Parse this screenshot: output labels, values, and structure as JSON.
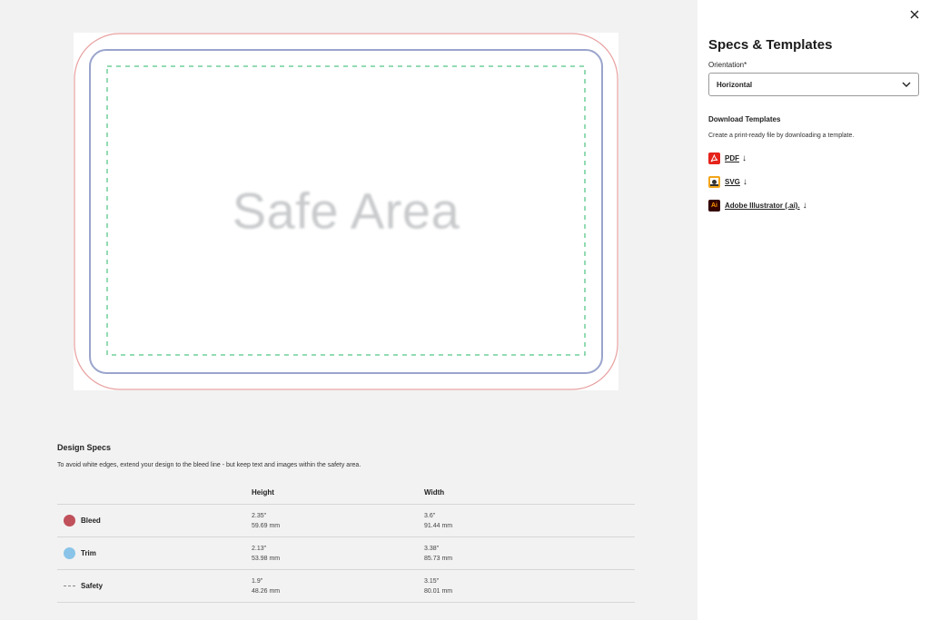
{
  "preview": {
    "safe_area_label": "Safe Area"
  },
  "specs": {
    "title": "Design Specs",
    "description": "To avoid white edges, extend your design to the bleed line - but keep text and images within the safety area.",
    "headers": {
      "height": "Height",
      "width": "Width"
    },
    "rows": [
      {
        "name": "Bleed",
        "marker": "dot",
        "color": "#c0505a",
        "height_in": "2.35\"",
        "height_mm": "59.69 mm",
        "width_in": "3.6\"",
        "width_mm": "91.44 mm"
      },
      {
        "name": "Trim",
        "marker": "dot",
        "color": "#8ac4e8",
        "height_in": "2.13\"",
        "height_mm": "53.98 mm",
        "width_in": "3.38\"",
        "width_mm": "85.73 mm"
      },
      {
        "name": "Safety",
        "marker": "dash",
        "color": "#888888",
        "height_in": "1.9\"",
        "height_mm": "48.26 mm",
        "width_in": "3.15\"",
        "width_mm": "80.01 mm"
      }
    ]
  },
  "panel": {
    "title": "Specs & Templates",
    "orientation_label": "Orientation*",
    "orientation_value": "Horizontal",
    "download_title": "Download Templates",
    "download_desc": "Create a print-ready file by downloading a template.",
    "downloads": [
      {
        "label": "PDF",
        "icon": "pdf-icon",
        "icon_text": "",
        "color": "#e5231b"
      },
      {
        "label": "SVG",
        "icon": "svg-icon",
        "icon_text": "",
        "color": "#f2a51a"
      },
      {
        "label": "Adobe Illustrator (.ai).",
        "icon": "illustrator-icon",
        "icon_text": "Ai",
        "color": "#330000"
      }
    ]
  },
  "colors": {
    "bleed": "#e8a0a0",
    "trim": "#9aa4cc",
    "safety": "#6fcf9a"
  }
}
